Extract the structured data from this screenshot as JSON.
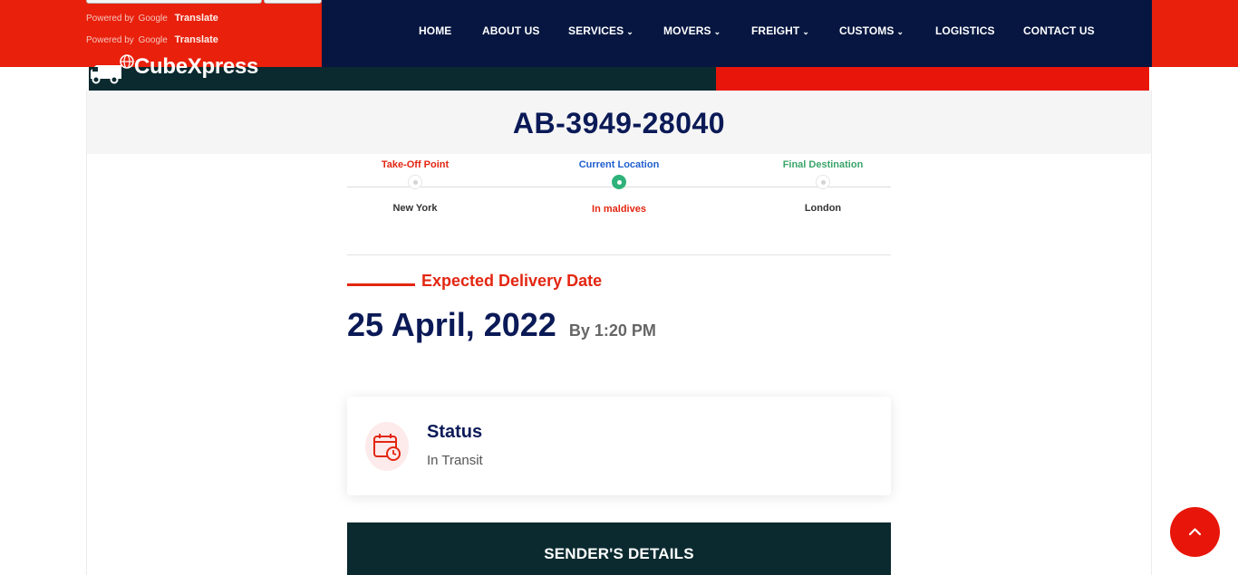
{
  "translate": {
    "powered_by": "Powered by",
    "google": "Google",
    "translate_label": "Translate"
  },
  "nav": {
    "items": [
      {
        "label": "HOME",
        "has_dropdown": false
      },
      {
        "label": "ABOUT US",
        "has_dropdown": false
      },
      {
        "label": "SERVICES",
        "has_dropdown": true
      },
      {
        "label": "MOVERS",
        "has_dropdown": true
      },
      {
        "label": "FREIGHT",
        "has_dropdown": true
      },
      {
        "label": "CUSTOMS",
        "has_dropdown": true
      },
      {
        "label": "LOGISTICS",
        "has_dropdown": false
      },
      {
        "label": "CONTACT US",
        "has_dropdown": false
      }
    ],
    "chevron": ""
  },
  "brand": {
    "name": "CubeXpress",
    "logo_icon": "truck-globe-icon"
  },
  "tracking": {
    "number": "AB-3949-28040",
    "route": {
      "origin_label": "Take-Off Point",
      "origin_city": "New York",
      "current_label": "Current Location",
      "current_city": "In maldives",
      "destination_label": "Final Destination",
      "destination_city": "London"
    }
  },
  "delivery": {
    "title": "Expected Delivery Date",
    "date": "25 April, 2022",
    "time": "By 1:20 PM"
  },
  "status": {
    "title": "Status",
    "value": "In Transit",
    "icon": "calendar-clock-icon"
  },
  "sender": {
    "title": "SENDER'S DETAILS"
  },
  "scroll_top": {
    "icon": "chevron-up-icon"
  },
  "colors": {
    "red": "#e8200c",
    "navy": "#061640",
    "dark_teal": "#0a2a2f",
    "heading_blue": "#0b1a57",
    "origin": "#e32611",
    "current": "#1f5fce",
    "destination": "#3aa46a",
    "active_dot": "#2fb27a"
  }
}
